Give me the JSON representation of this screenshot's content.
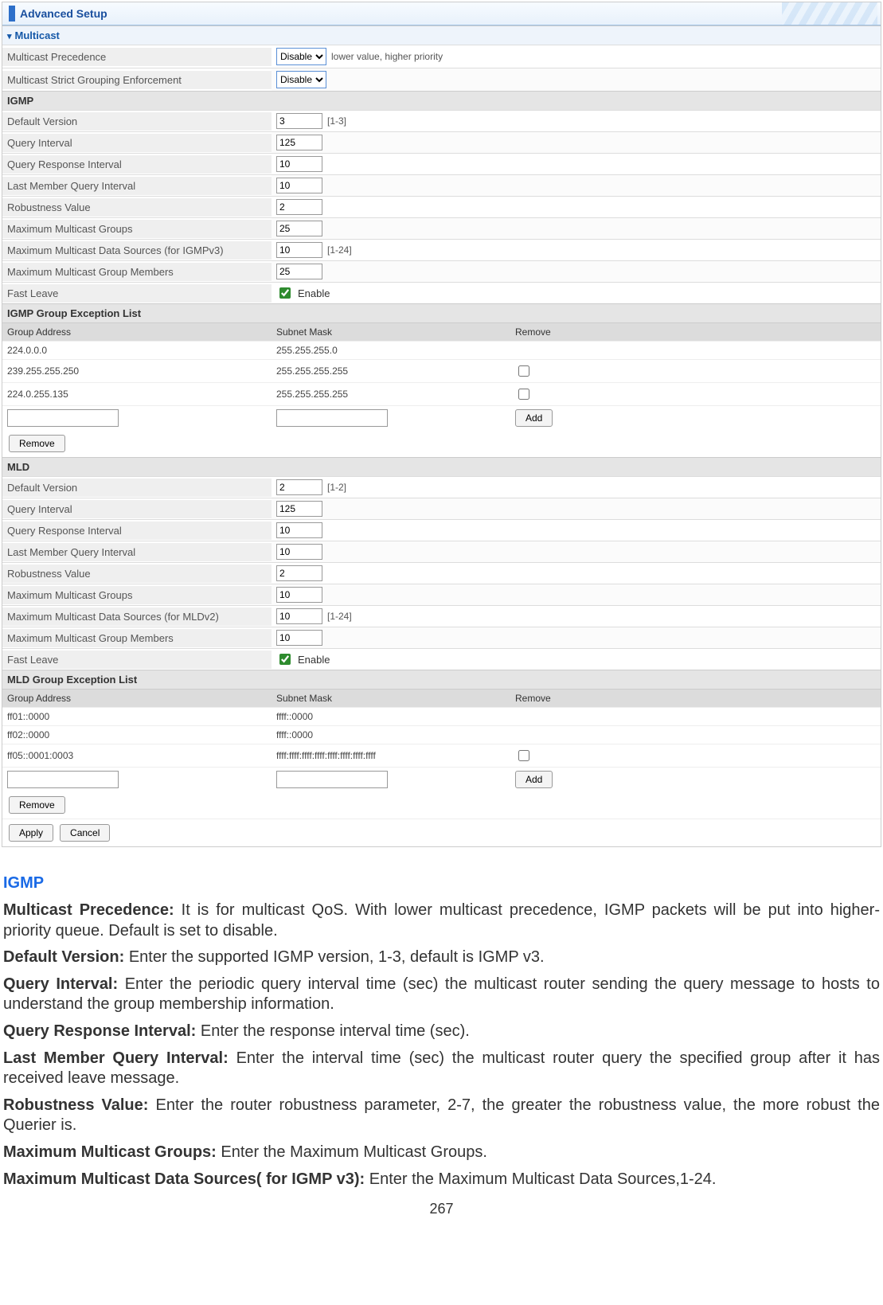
{
  "header": {
    "title": "Advanced Setup"
  },
  "sections": {
    "multicast_title": "Multicast",
    "multicast": [
      {
        "label": "Multicast Precedence",
        "type": "select",
        "value": "Disable",
        "hint": "lower value, higher priority"
      },
      {
        "label": "Multicast Strict Grouping Enforcement",
        "type": "select",
        "value": "Disable"
      }
    ],
    "igmp_title": "IGMP",
    "igmp": [
      {
        "label": "Default Version",
        "value": "3",
        "hint": "[1-3]"
      },
      {
        "label": "Query Interval",
        "value": "125"
      },
      {
        "label": "Query Response Interval",
        "value": "10"
      },
      {
        "label": "Last Member Query Interval",
        "value": "10"
      },
      {
        "label": "Robustness Value",
        "value": "2"
      },
      {
        "label": "Maximum Multicast Groups",
        "value": "25"
      },
      {
        "label": "Maximum Multicast Data Sources (for IGMPv3)",
        "value": "10",
        "hint": "[1-24]"
      },
      {
        "label": "Maximum Multicast Group Members",
        "value": "25"
      },
      {
        "label": "Fast Leave",
        "type": "check",
        "checked": true,
        "chk_label": "Enable"
      }
    ],
    "igmp_exc_title": "IGMP Group Exception List",
    "exc_headers": {
      "addr": "Group Address",
      "mask": "Subnet Mask",
      "remove": "Remove"
    },
    "igmp_exc_rows": [
      {
        "addr": "224.0.0.0",
        "mask": "255.255.255.0",
        "removable": false
      },
      {
        "addr": "239.255.255.250",
        "mask": "255.255.255.255",
        "removable": true
      },
      {
        "addr": "224.0.255.135",
        "mask": "255.255.255.255",
        "removable": true
      }
    ],
    "mld_title": "MLD",
    "mld": [
      {
        "label": "Default Version",
        "value": "2",
        "hint": "[1-2]"
      },
      {
        "label": "Query Interval",
        "value": "125"
      },
      {
        "label": "Query Response Interval",
        "value": "10"
      },
      {
        "label": "Last Member Query Interval",
        "value": "10"
      },
      {
        "label": "Robustness Value",
        "value": "2"
      },
      {
        "label": "Maximum Multicast Groups",
        "value": "10"
      },
      {
        "label": "Maximum Multicast Data Sources (for MLDv2)",
        "value": "10",
        "hint": "[1-24]"
      },
      {
        "label": "Maximum Multicast Group Members",
        "value": "10"
      },
      {
        "label": "Fast Leave",
        "type": "check",
        "checked": true,
        "chk_label": "Enable"
      }
    ],
    "mld_exc_title": "MLD Group Exception List",
    "mld_exc_rows": [
      {
        "addr": "ff01::0000",
        "mask": "ffff::0000",
        "removable": false
      },
      {
        "addr": "ff02::0000",
        "mask": "ffff::0000",
        "removable": false
      },
      {
        "addr": "ff05::0001:0003",
        "mask": "ffff:ffff:ffff:ffff:ffff:ffff:ffff:ffff",
        "removable": true
      }
    ],
    "buttons": {
      "add": "Add",
      "remove": "Remove",
      "apply": "Apply",
      "cancel": "Cancel"
    }
  },
  "doc": {
    "heading": "IGMP",
    "paras": [
      {
        "b": "Multicast Precedence:",
        "t": " It is for multicast QoS. With lower multicast precedence, IGMP packets will be put into higher-priority queue. Default is set to disable."
      },
      {
        "b": "Default Version:",
        "t": " Enter the supported IGMP version, 1-3, default is IGMP v3."
      },
      {
        "b": "Query Interval:",
        "t": " Enter the periodic query interval time (sec) the multicast router sending the query message to hosts to understand the group membership information."
      },
      {
        "b": "Query Response Interval:",
        "t": " Enter the response interval time (sec)."
      },
      {
        "b": "Last Member Query Interval:",
        "t": " Enter the interval time (sec) the multicast router query the specified group after it has received leave message."
      },
      {
        "b": "Robustness Value:",
        "t": " Enter the router robustness parameter, 2-7, the greater the robustness value, the more robust the Querier is."
      },
      {
        "b": "Maximum Multicast Groups:",
        "t": " Enter the Maximum Multicast Groups."
      },
      {
        "b": "Maximum Multicast Data Sources( for IGMP v3):",
        "t": " Enter the Maximum Multicast Data Sources,1-24."
      }
    ],
    "pagenum": "267"
  }
}
